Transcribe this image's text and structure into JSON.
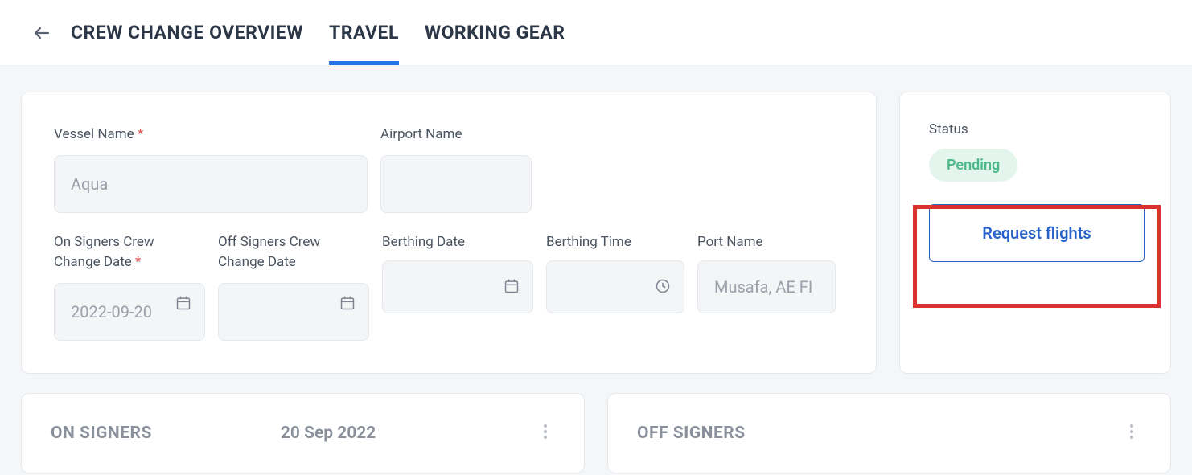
{
  "header": {
    "tabs": [
      {
        "label": "CREW CHANGE OVERVIEW",
        "active": false
      },
      {
        "label": "TRAVEL",
        "active": true
      },
      {
        "label": "WORKING GEAR",
        "active": false
      }
    ]
  },
  "form": {
    "vessel_name": {
      "label": "Vessel Name",
      "value": "Aqua",
      "required": true
    },
    "airport_name": {
      "label": "Airport Name",
      "value": ""
    },
    "on_signers_date": {
      "label_line1": "On Signers Crew",
      "label_line2": "Change Date",
      "value": "2022-09-20",
      "required": true
    },
    "off_signers_date": {
      "label_line1": "Off Signers Crew",
      "label_line2": "Change Date",
      "value": ""
    },
    "berthing_date": {
      "label": "Berthing Date",
      "value": ""
    },
    "berthing_time": {
      "label": "Berthing Time",
      "value": ""
    },
    "port_name": {
      "label": "Port Name",
      "value": "Musafa, AE FI"
    }
  },
  "side": {
    "status_label": "Status",
    "status_value": "Pending",
    "request_button": "Request flights"
  },
  "panels": {
    "on_signers": {
      "title": "ON SIGNERS",
      "date": "20 Sep 2022"
    },
    "off_signers": {
      "title": "OFF SIGNERS",
      "date": ""
    }
  }
}
